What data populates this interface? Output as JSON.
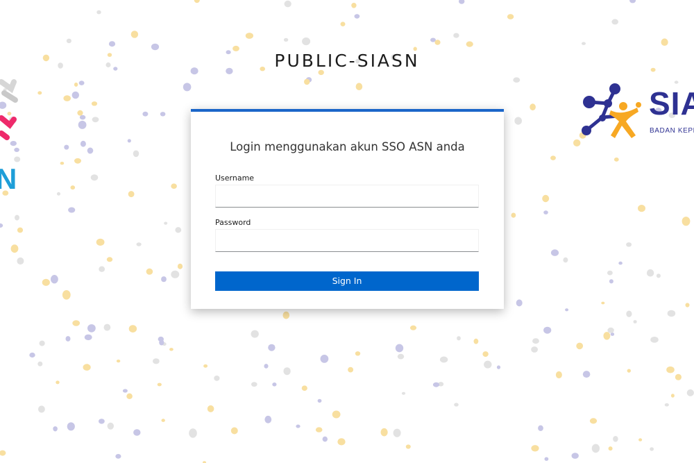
{
  "app_title": "PUBLIC-SIASN",
  "brand": {
    "left_logo_letter": "N",
    "right_logo_word": "SIA",
    "right_logo_subtitle": "BADAN KEPE"
  },
  "login": {
    "heading": "Login menggunakan akun SSO ASN anda",
    "username_label": "Username",
    "username_value": "",
    "password_label": "Password",
    "password_value": "",
    "submit_label": "Sign In"
  },
  "colors": {
    "accent": "#0066cc",
    "card_top_border": "#1b66c9",
    "brand_navy": "#2e3192",
    "brand_orange": "#f7a823",
    "confetti_yellow": "#f8dfa0",
    "confetti_lavender": "#c7c6e6",
    "confetti_gray": "#e2e2e2"
  }
}
